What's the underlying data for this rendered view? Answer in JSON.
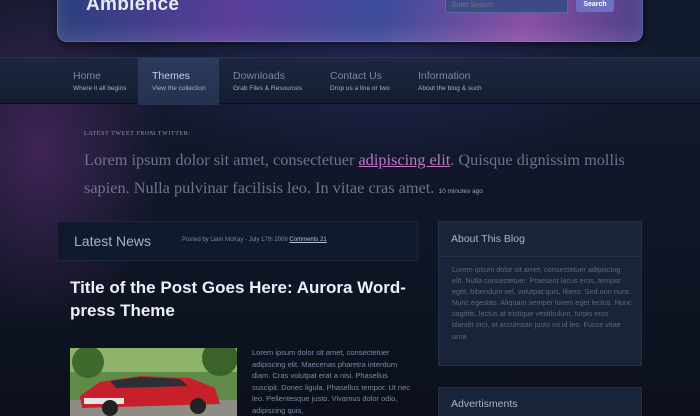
{
  "header": {
    "site_title": "Ambience",
    "search_placeholder": "Enter Search",
    "search_button": "Search"
  },
  "nav": [
    {
      "label": "Home",
      "sub": "Where it all begins",
      "active": false
    },
    {
      "label": "Themes",
      "sub": "View the collection",
      "active": true
    },
    {
      "label": "Downloads",
      "sub": "Grab Files & Resources",
      "active": false
    },
    {
      "label": "Contact Us",
      "sub": "Drop us a line or two",
      "active": false
    },
    {
      "label": "Information",
      "sub": "About the blog & such",
      "active": false
    }
  ],
  "tweet": {
    "heading": "Latest Tweet from Twitter:",
    "text_before": "Lorem ipsum dolor sit amet, consectetuer ",
    "link": "adipiscing elit",
    "text_after": ". Quisque dignissim mollis sapien. Nulla pulvinar facilisis leo. In vitae cras amet.",
    "time": "10 minutes ago"
  },
  "main": {
    "section_title": "Latest News",
    "meta": "Posted by Liam McKay - July 17th 2008",
    "comments": "Comments 21",
    "post_title": "Title of the Post Goes Here: Aurora Word-press Theme",
    "excerpt": "Lorem ipsum dolor sit amet, consectetuer adipiscing elit. Maecenas pharetra interdum diam. Cras volutpat erat a nisi. Phasellus suscipit. Donec ligula. Phasellus tempor. Ut nec leo. Pellentesque justo. Vivamus dolor odio, adipiscing quis,"
  },
  "sidebar": {
    "about_title": "About This Blog",
    "about_text": "Lorem ipsum dolor sit amet, consectetuer adipiscing elit. Nulla consectetuer. Praesent lacus eros, tempor eget, bibendum vel, volutpat quis, libero. Sed non nunc. Nunc egestas. Aliquam semper lorem eget lectus. Nunc sagittis, lectus at tristique vestibulum, turpis eros blandit orci, at accumsan justo mi id leo. Fusce vitae urna",
    "ads_title": "Advertisments"
  }
}
